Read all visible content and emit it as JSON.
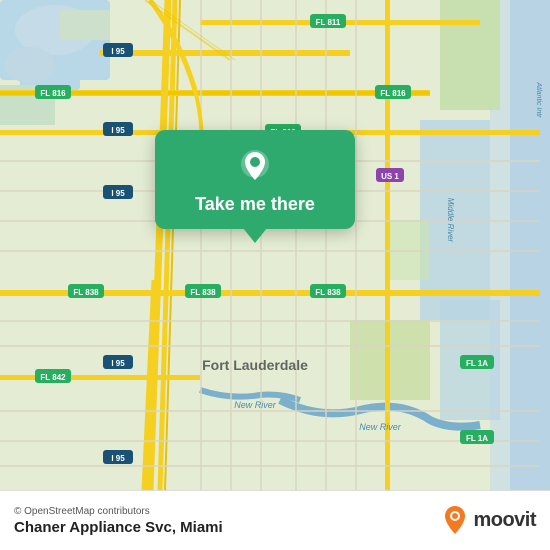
{
  "map": {
    "background_color": "#e4edd4",
    "attribution": "© OpenStreetMap contributors",
    "location_name": "Chaner Appliance Svc, Miami"
  },
  "popup": {
    "label": "Take me there",
    "icon": "location-pin-icon"
  },
  "moovit": {
    "text": "moovit",
    "logo_icon": "moovit-logo-icon"
  },
  "road_labels": [
    "I 95",
    "FL 811",
    "FL 816",
    "FL 816",
    "FL 816",
    "US 1",
    "I 95",
    "I 95",
    "FL 838",
    "FL 838",
    "FL 838",
    "I 95",
    "FL 842",
    "FL 1A",
    "FL 1A",
    "Fort Lauderdale",
    "New River",
    "New River",
    "Middle River",
    "Atlantic Intr"
  ]
}
